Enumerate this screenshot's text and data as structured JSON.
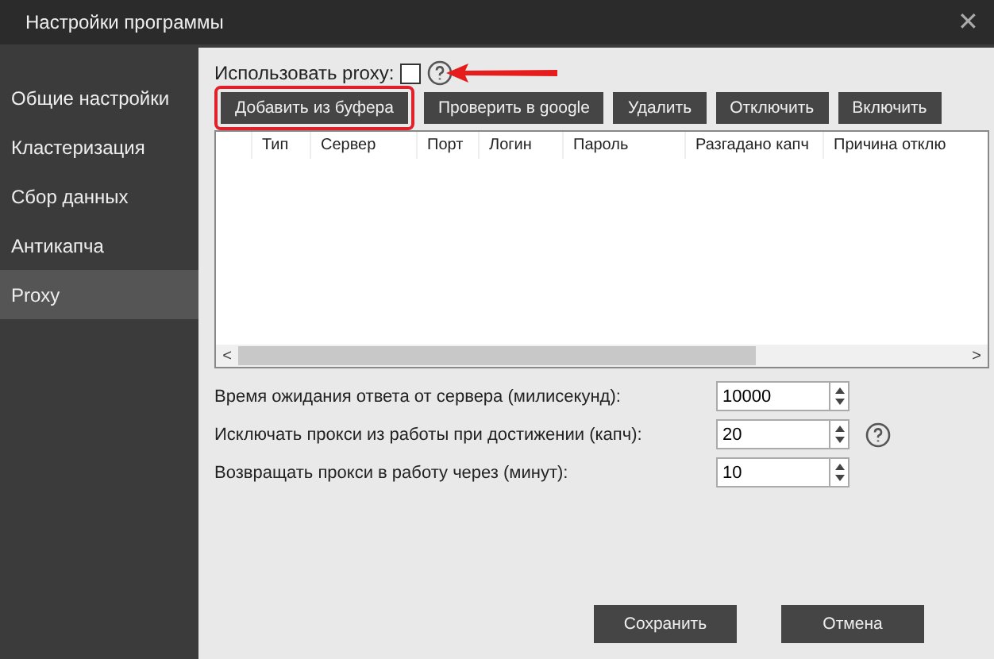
{
  "window": {
    "title": "Настройки программы",
    "close": "✕"
  },
  "sidebar": {
    "items": [
      {
        "label": "Общие настройки",
        "selected": false
      },
      {
        "label": "Кластеризация",
        "selected": false
      },
      {
        "label": "Сбор данных",
        "selected": false
      },
      {
        "label": "Антикапча",
        "selected": false
      },
      {
        "label": "Proxy",
        "selected": true
      }
    ]
  },
  "use_proxy": {
    "label": "Использовать proxy:",
    "checked": false
  },
  "toolbar": [
    {
      "label": "Добавить из буфера",
      "highlighted": true
    },
    {
      "label": "Проверить в google",
      "highlighted": false
    },
    {
      "label": "Удалить",
      "highlighted": false
    },
    {
      "label": "Отключить",
      "highlighted": false
    },
    {
      "label": "Включить",
      "highlighted": false
    }
  ],
  "table": {
    "columns": [
      "Тип",
      "Сервер",
      "Порт",
      "Логин",
      "Пароль",
      "Разгадано капч",
      "Причина отклю"
    ],
    "scroll_left": "<",
    "scroll_right": ">"
  },
  "settings": [
    {
      "label": "Время ожидания ответа от сервера (милисекунд):",
      "value": "10000",
      "help": false
    },
    {
      "label": "Исключать прокси из работы при достижении (капч):",
      "value": "20",
      "help": true
    },
    {
      "label": "Возвращать прокси в работу через (минут):",
      "value": "10",
      "help": false
    }
  ],
  "footer": {
    "buttons": [
      "Сохранить",
      "Отмена"
    ]
  }
}
